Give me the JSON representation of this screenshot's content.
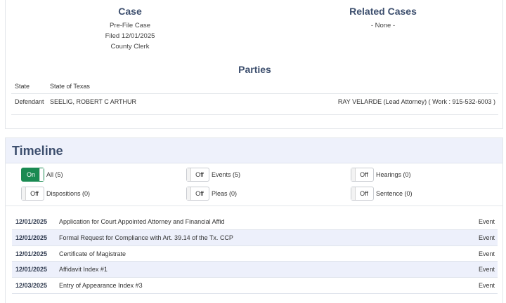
{
  "case": {
    "heading": "Case",
    "lines": [
      "Pre-File Case",
      "Filed 12/01/2025",
      "County Clerk"
    ]
  },
  "related": {
    "heading": "Related Cases",
    "value": "- None -"
  },
  "parties": {
    "heading": "Parties",
    "rows": [
      {
        "role": "State",
        "name": "State of Texas",
        "attorney": ""
      },
      {
        "role": "Defendant",
        "name": "SEELIG, ROBERT C ARTHUR",
        "attorney": "RAY VELARDE (Lead Attorney) ( Work : 915-532-6003 )"
      }
    ]
  },
  "timeline": {
    "heading": "Timeline",
    "toggles": [
      {
        "state": "On",
        "label": "All (5)"
      },
      {
        "state": "Off",
        "label": "Events (5)"
      },
      {
        "state": "Off",
        "label": "Hearings (0)"
      },
      {
        "state": "Off",
        "label": "Dispositions (0)"
      },
      {
        "state": "Off",
        "label": "Pleas (0)"
      },
      {
        "state": "Off",
        "label": "Sentence (0)"
      }
    ],
    "events": [
      {
        "date": "12/01/2025",
        "description": "Application for Court Appointed Attorney and Financial Affid",
        "type": "Event"
      },
      {
        "date": "12/01/2025",
        "description": "Formal Request for Compliance with Art. 39.14 of the Tx. CCP",
        "type": "Event"
      },
      {
        "date": "12/01/2025",
        "description": "Certificate of Magistrate",
        "type": "Event"
      },
      {
        "date": "12/01/2025",
        "description": "Affidavit Index #1",
        "type": "Event"
      },
      {
        "date": "12/03/2025",
        "description": "Entry of Appearance Index #3",
        "type": "Event"
      }
    ]
  },
  "colors": {
    "heading": "#3d4f6e",
    "toggle_on": "#1a8a52",
    "header_bg": "#eef1fb",
    "row_alt": "#edf0fb"
  }
}
